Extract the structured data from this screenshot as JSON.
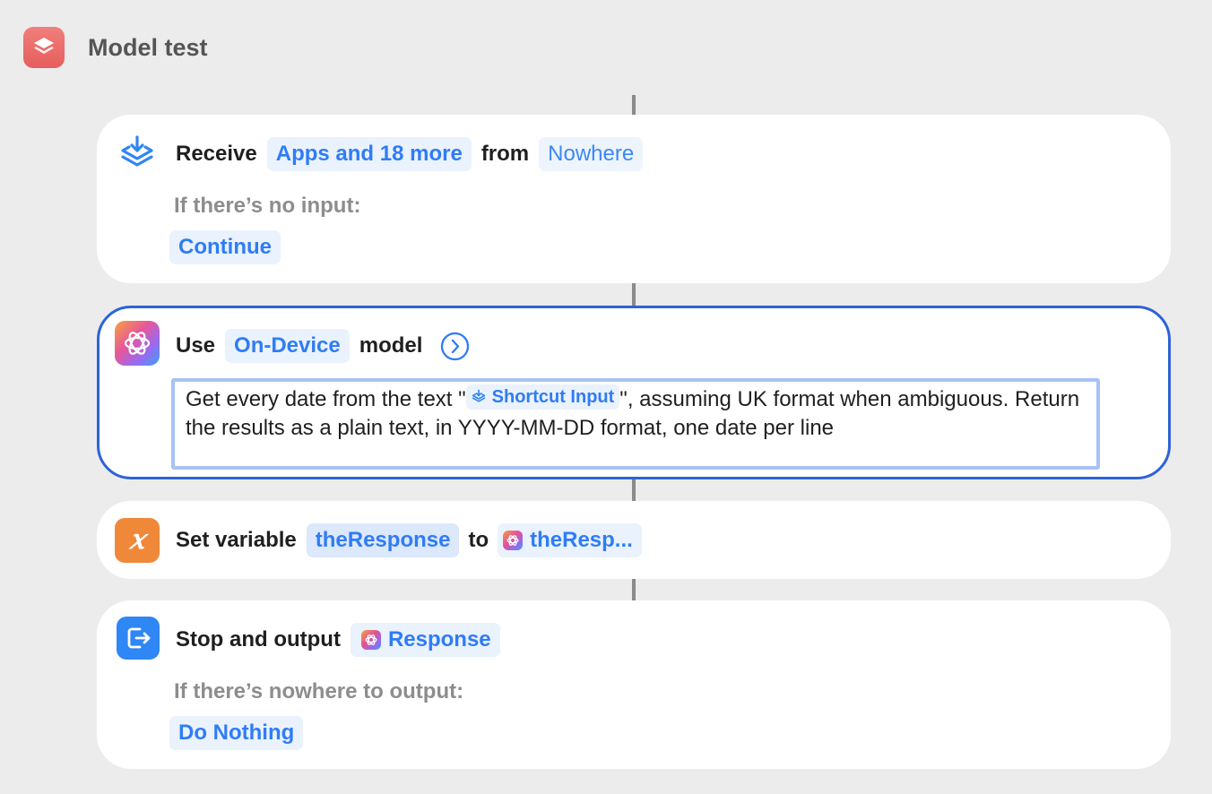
{
  "header": {
    "title": "Model test",
    "icon": "shortcuts-app-icon"
  },
  "actions": {
    "receive": {
      "icon": "receive-icon",
      "verb": "Receive",
      "types_token": "Apps and 18 more",
      "from_word": "from",
      "source_token": "Nowhere",
      "no_input_label": "If there’s no input:",
      "no_input_value": "Continue"
    },
    "model": {
      "icon": "apple-intelligence-icon",
      "verb": "Use",
      "model_token": "On-Device",
      "model_word": "model",
      "expand_icon": "chevron-right-circle-icon",
      "prompt_before": "Get every date from the text \"",
      "prompt_token": "Shortcut Input",
      "prompt_after": "\", assuming UK format when ambiguous. Return the results as a plain text, in YYYY-MM-DD format, one date per line"
    },
    "set_variable": {
      "icon": "variable-x-icon",
      "verb": "Set variable",
      "variable_token": "theResponse",
      "to_word": "to",
      "value_token": "theResp..."
    },
    "stop_output": {
      "icon": "exit-icon",
      "verb": "Stop and output",
      "output_token": "Response",
      "fallback_label": "If there’s nowhere to output:",
      "fallback_value": "Do Nothing"
    }
  },
  "colors": {
    "background": "#ececec",
    "accent": "#2f7cf6",
    "selection": "#2d63d8",
    "app_icon": "#e65e5e",
    "variable_icon": "#f0883a",
    "exit_icon": "#2f86f5"
  }
}
